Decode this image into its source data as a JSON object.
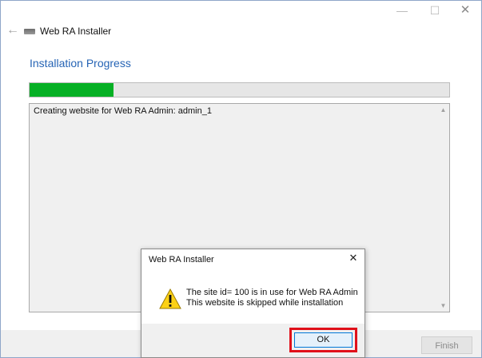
{
  "window": {
    "title": "Web RA  Installer",
    "minimize_glyph": "—",
    "maximize_glyph": "☐",
    "close_glyph": "✕",
    "back_glyph": "←"
  },
  "page": {
    "title": "Installation Progress"
  },
  "progress": {
    "fraction": 0.2,
    "color": "#06b025"
  },
  "log": {
    "lines": [
      "Creating website for Web RA Admin: admin_1"
    ],
    "scroll_up_glyph": "▲",
    "scroll_down_glyph": "▼"
  },
  "footer": {
    "finish_label": "Finish"
  },
  "dialog": {
    "title": "Web RA  Installer",
    "close_glyph": "✕",
    "message_line1": "The site id= 100 is in use for Web RA Admin",
    "message_line2": "This website is skipped while installation",
    "ok_label": "OK",
    "icon": "warning-icon",
    "highlight_color": "#e0101a"
  }
}
